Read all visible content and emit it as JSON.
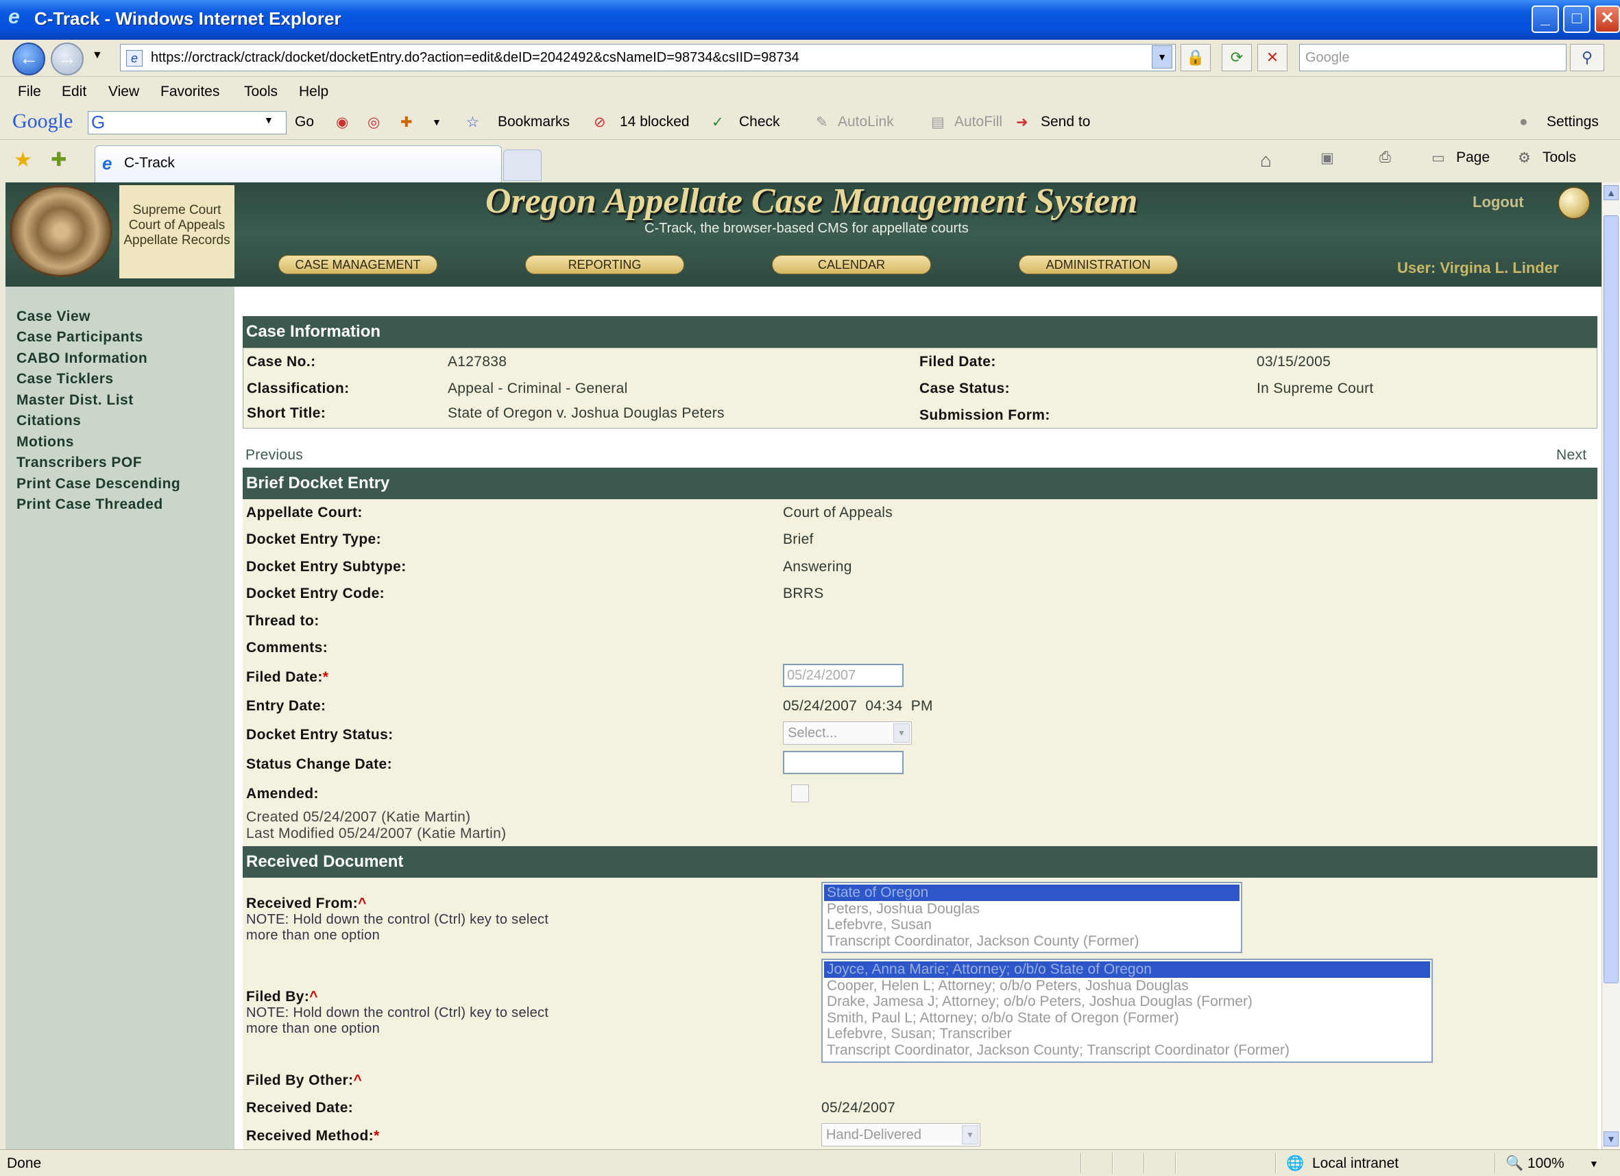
{
  "window": {
    "title": "C-Track - Windows Internet Explorer"
  },
  "address": {
    "url": "https://orctrack/ctrack/docket/docketEntry.do?action=edit&deID=2042492&csNameID=98734&csIID=98734",
    "search_placeholder": "Google"
  },
  "menu": [
    "File",
    "Edit",
    "View",
    "Favorites",
    "Tools",
    "Help"
  ],
  "google_toolbar": {
    "logo": "Google",
    "go": "Go",
    "bookmarks": "Bookmarks",
    "blocked": "14 blocked",
    "check": "Check",
    "autolink": "AutoLink",
    "autofill": "AutoFill",
    "send_to": "Send to",
    "settings": "Settings"
  },
  "tab": {
    "label": "C-Track",
    "page_menu": "Page",
    "tools_menu": "Tools"
  },
  "app": {
    "title": "Oregon Appellate Case Management System",
    "subtitle": "C-Track, the browser-based CMS for appellate courts",
    "seal_text": [
      "Supreme Court",
      "Court of Appeals",
      "Appellate Records"
    ],
    "nav": [
      "CASE MANAGEMENT",
      "REPORTING",
      "CALENDAR",
      "ADMINISTRATION"
    ],
    "logout": "Logout",
    "user": "User: Virgina L. Linder"
  },
  "sidebar": [
    "Case View",
    "Case Participants",
    "CABO Information",
    "Case Ticklers",
    "Master Dist. List",
    "Citations",
    "Motions",
    "Transcribers POF",
    "Print Case Descending",
    "Print Case Threaded"
  ],
  "case_info": {
    "header": "Case Information",
    "case_no_label": "Case No.:",
    "case_no": "A127838",
    "classification_label": "Classification:",
    "classification": "Appeal - Criminal - General",
    "short_title_label": "Short Title:",
    "short_title": "State of Oregon v. Joshua Douglas Peters",
    "filed_date_label": "Filed Date:",
    "filed_date": "03/15/2005",
    "case_status_label": "Case Status:",
    "case_status": "In Supreme Court",
    "submission_form_label": "Submission Form:"
  },
  "pager": {
    "previous": "Previous",
    "next": "Next"
  },
  "docket": {
    "header": "Brief Docket Entry",
    "appellate_court_label": "Appellate Court:",
    "appellate_court": "Court of Appeals",
    "type_label": "Docket Entry Type:",
    "type": "Brief",
    "subtype_label": "Docket Entry Subtype:",
    "subtype": "Answering",
    "code_label": "Docket Entry Code:",
    "code": "BRRS",
    "thread_label": "Thread to:",
    "comments_label": "Comments:",
    "filed_date_label": "Filed Date:",
    "filed_date": "05/24/2007",
    "entry_date_label": "Entry Date:",
    "entry_date": "05/24/2007  04:34  PM",
    "status_label": "Docket Entry Status:",
    "status_placeholder": "Select...",
    "status_change_label": "Status Change Date:",
    "amended_label": "Amended:",
    "created": "Created 05/24/2007 (Katie Martin)",
    "modified": "Last Modified 05/24/2007 (Katie Martin)"
  },
  "received": {
    "header": "Received Document",
    "from_label": "Received From:",
    "note": "NOTE: Hold down the control (Ctrl) key to select more than one option",
    "from_options": [
      "State of Oregon",
      "Peters, Joshua Douglas",
      "Lefebvre, Susan",
      "Transcript Coordinator, Jackson County (Former)"
    ],
    "filed_by_label": "Filed By:",
    "filed_by_options": [
      "Joyce, Anna Marie; Attorney; o/b/o State of Oregon",
      "Cooper, Helen L; Attorney; o/b/o Peters, Joshua Douglas",
      "Drake, Jamesa J; Attorney; o/b/o Peters, Joshua Douglas (Former)",
      "Smith, Paul L; Attorney; o/b/o State of Oregon (Former)",
      "Lefebvre, Susan; Transcriber",
      "Transcript Coordinator, Jackson County; Transcript Coordinator (Former)"
    ],
    "filed_by_other_label": "Filed By Other:",
    "received_date_label": "Received Date:",
    "received_date": "05/24/2007",
    "method_label": "Received Method:",
    "method": "Hand-Delivered"
  },
  "status_bar": {
    "text": "Done",
    "zone": "Local intranet",
    "zoom": "100%"
  }
}
